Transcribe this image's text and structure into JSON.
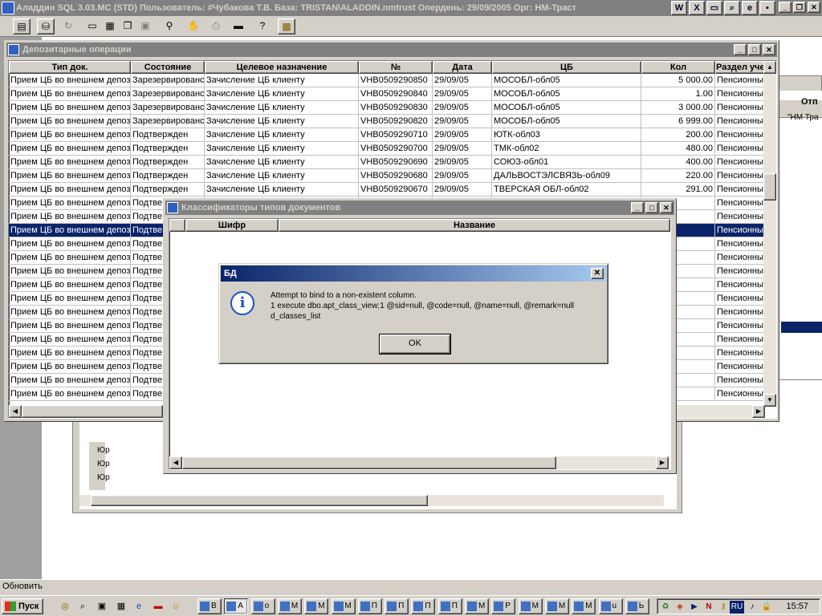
{
  "app": {
    "title": "Аладдин SQL 3.03.MC (STD)  Пользователь: #Чубакова Т.В. База: TRISTAN\\ALADDIN.nmtrust Опердень: 29/09/2005 Орг: НМ-Траст"
  },
  "bg_right_labels": {
    "otp": "Отп",
    "nm": "\"НМ Тра"
  },
  "bg_left_labels": [
    "Юр",
    "Юр",
    "Юр"
  ],
  "depo": {
    "title": "Депозитарные операции",
    "columns": [
      "Тип док.",
      "Состояние",
      "Целевое назначение",
      "№",
      "Дата",
      "ЦБ",
      "Кол",
      "Раздел уче"
    ],
    "rows": [
      [
        "Прием ЦБ во внешнем депоз",
        "Зарезервированс",
        "Зачисление ЦБ клиенту",
        "VHB0509290850",
        "29/09/05",
        "МОСОБЛ-обл05",
        "5 000.00",
        "Пенсионные резервы"
      ],
      [
        "Прием ЦБ во внешнем депоз",
        "Зарезервированс",
        "Зачисление ЦБ клиенту",
        "VHB0509290840",
        "29/09/05",
        "МОСОБЛ-обл05",
        "1.00",
        "Пенсионные резервы"
      ],
      [
        "Прием ЦБ во внешнем депоз",
        "Зарезервированс",
        "Зачисление ЦБ клиенту",
        "VHB0509290830",
        "29/09/05",
        "МОСОБЛ-обл05",
        "3 000.00",
        "Пенсионные резервы"
      ],
      [
        "Прием ЦБ во внешнем депоз",
        "Зарезервированс",
        "Зачисление ЦБ клиенту",
        "VHB0509290820",
        "29/09/05",
        "МОСОБЛ-обл05",
        "6 999.00",
        "Пенсионные резервы"
      ],
      [
        "Прием ЦБ во внешнем депоз",
        "Подтвержден",
        "Зачисление ЦБ клиенту",
        "VHB0509290710",
        "29/09/05",
        "ЮТК-обл03",
        "200.00",
        "Пенсионные резервы"
      ],
      [
        "Прием ЦБ во внешнем депоз",
        "Подтвержден",
        "Зачисление ЦБ клиенту",
        "VHB0509290700",
        "29/09/05",
        "ТМК-обл02",
        "480.00",
        "Пенсионные резервы"
      ],
      [
        "Прием ЦБ во внешнем депоз",
        "Подтвержден",
        "Зачисление ЦБ клиенту",
        "VHB0509290690",
        "29/09/05",
        "СОЮЗ-обл01",
        "400.00",
        "Пенсионные резервы"
      ],
      [
        "Прием ЦБ во внешнем депоз",
        "Подтвержден",
        "Зачисление ЦБ клиенту",
        "VHB0509290680",
        "29/09/05",
        "ДАЛЬВОСТЭЛСВЯЗЬ-обл09",
        "220.00",
        "Пенсионные резервы"
      ],
      [
        "Прием ЦБ во внешнем депоз",
        "Подтвержден",
        "Зачисление ЦБ клиенту",
        "VHB0509290670",
        "29/09/05",
        "ТВЕРСКАЯ ОБЛ-обл02",
        "291.00",
        "Пенсионные резервы"
      ],
      [
        "Прием ЦБ во внешнем депоз",
        "Подтве",
        "",
        "",
        "",
        "",
        "",
        "Пенсионные резервы"
      ],
      [
        "Прием ЦБ во внешнем депоз",
        "Подтве",
        "",
        "",
        "",
        "",
        "",
        "Пенсионные резервы"
      ],
      [
        "Прием ЦБ во внешнем депоз",
        "Подтве",
        "",
        "",
        "",
        "",
        "",
        "Пенсионные резервы"
      ],
      [
        "Прием ЦБ во внешнем депоз",
        "Подтве",
        "",
        "",
        "",
        "",
        "",
        "Пенсионные резервы"
      ],
      [
        "Прием ЦБ во внешнем депоз",
        "Подтве",
        "",
        "",
        "",
        "",
        "",
        "Пенсионные резервы"
      ],
      [
        "Прием ЦБ во внешнем депоз",
        "Подтве",
        "",
        "",
        "",
        "",
        "",
        "Пенсионные резервы"
      ],
      [
        "Прием ЦБ во внешнем депоз",
        "Подтве",
        "",
        "",
        "",
        "",
        "",
        "Пенсионные резервы"
      ],
      [
        "Прием ЦБ во внешнем депоз",
        "Подтве",
        "",
        "",
        "",
        "",
        "",
        "Пенсионные резервы"
      ],
      [
        "Прием ЦБ во внешнем депоз",
        "Подтве",
        "",
        "",
        "",
        "",
        "",
        "Пенсионные резервы"
      ],
      [
        "Прием ЦБ во внешнем депоз",
        "Подтве",
        "",
        "",
        "",
        "",
        "",
        "Пенсионные резервы"
      ],
      [
        "Прием ЦБ во внешнем депоз",
        "Подтве",
        "",
        "",
        "",
        "",
        "",
        "Пенсионные резервы"
      ],
      [
        "Прием ЦБ во внешнем депоз",
        "Подтве",
        "",
        "",
        "",
        "",
        "",
        "Пенсионные резервы"
      ],
      [
        "Прием ЦБ во внешнем депоз",
        "Подтве",
        "",
        "",
        "",
        "",
        "",
        "Пенсионные резервы"
      ],
      [
        "Прием ЦБ во внешнем депоз",
        "Подтве",
        "",
        "",
        "",
        "",
        "",
        "Пенсионные резервы"
      ],
      [
        "Прием ЦБ во внешнем депоз",
        "Подтве",
        "",
        "",
        "",
        "",
        "",
        "Пенсионные резервы"
      ]
    ],
    "selected_row": 11
  },
  "klass": {
    "title": "Классификаторы типов документов",
    "columns": [
      "",
      "Шифр",
      "Название"
    ]
  },
  "dialog": {
    "title": "БД",
    "lines": [
      "Attempt to bind to a non-existent column.",
      "1 execute dbo.apt_class_view;1 @sid=null, @code=null, @name=null, @remark=null",
      "d_classes_list"
    ],
    "ok_label": "OK"
  },
  "status": {
    "text": "Обновить"
  },
  "taskbar": {
    "start_label": "Пуск",
    "tasks": [
      "В",
      "А",
      "o",
      "М",
      "М",
      "М",
      "П",
      "П",
      "П",
      "П",
      "М",
      "Р",
      "М",
      "М",
      "М",
      "u",
      "Ь"
    ],
    "active_task": 1,
    "clock": "15:57",
    "lang": "RU"
  }
}
